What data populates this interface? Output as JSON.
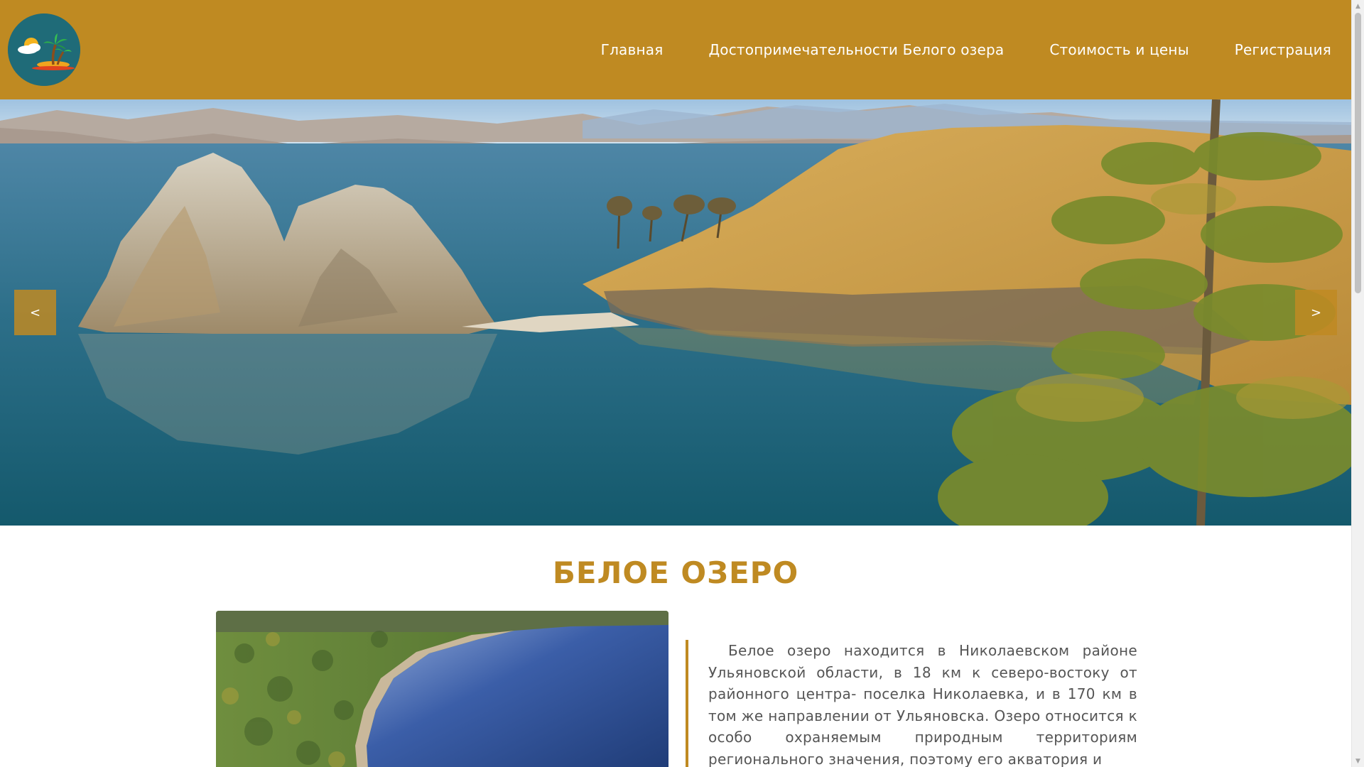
{
  "header": {
    "logo_icon": "palm-island-icon",
    "nav": [
      {
        "label": "Главная"
      },
      {
        "label": "Достопримечательности Белого озера"
      },
      {
        "label": "Стоимость и цены"
      },
      {
        "label": "Регистрация"
      }
    ],
    "colors": {
      "accent": "#bf8a22",
      "nav_text": "#ffffff"
    }
  },
  "hero": {
    "image": "lake-rocks-landscape",
    "prev_label": "<",
    "next_label": ">"
  },
  "main": {
    "title": "БЕЛОЕ ОЗЕРО",
    "photo": "aerial-lake-forest",
    "paragraph": "Белое озеро находится в Николаевском районе Ульяновской области, в 18 км к северо-востоку от районного центра- поселка Николаевка, и в 170 км в том же направлении от Ульяновска. Озеро относится к особо охраняемым природным территориям регионального значения, поэтому его акватория и"
  }
}
